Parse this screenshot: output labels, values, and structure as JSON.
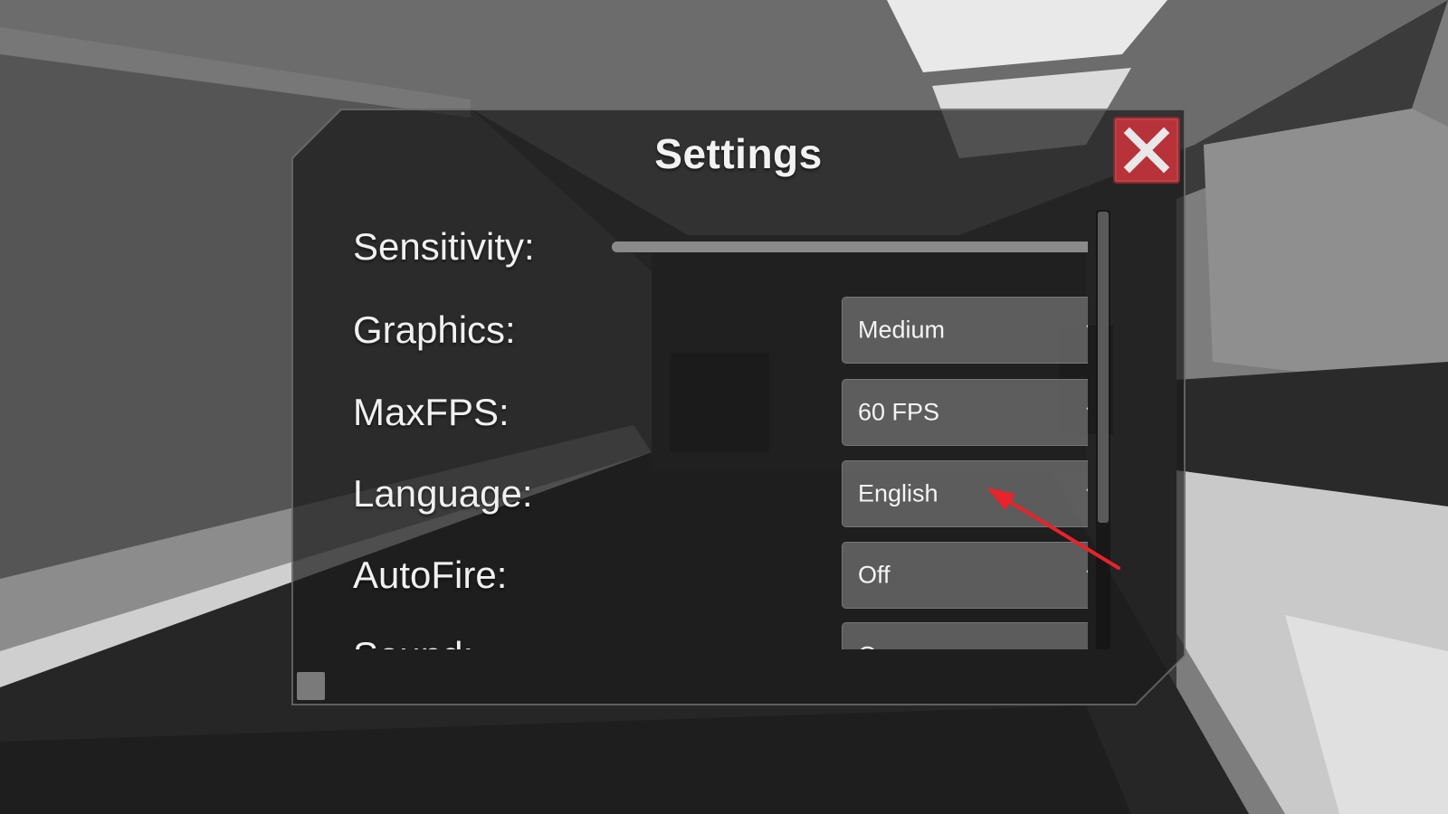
{
  "title": "Settings",
  "close": {
    "icon": "close-x-icon",
    "color": "#b8323a"
  },
  "settings": {
    "sensitivity": {
      "label": "Sensitivity:",
      "level": 0.98
    },
    "graphics": {
      "label": "Graphics:",
      "value": "Medium"
    },
    "maxfps": {
      "label": "MaxFPS:",
      "value": "60 FPS"
    },
    "language": {
      "label": "Language:",
      "value": "English"
    },
    "autofire": {
      "label": "AutoFire:",
      "value": "Off"
    },
    "sound": {
      "label": "Sound:",
      "value": "On"
    }
  },
  "scrollbar": {
    "position": 0.0,
    "visible_fraction": 0.7
  },
  "annotation": {
    "color": "#e8232b",
    "icon": "red-arrow-pointer"
  },
  "icons": {
    "dropdown": "chevron-down-icon",
    "corner": "resize-handle-icon"
  }
}
